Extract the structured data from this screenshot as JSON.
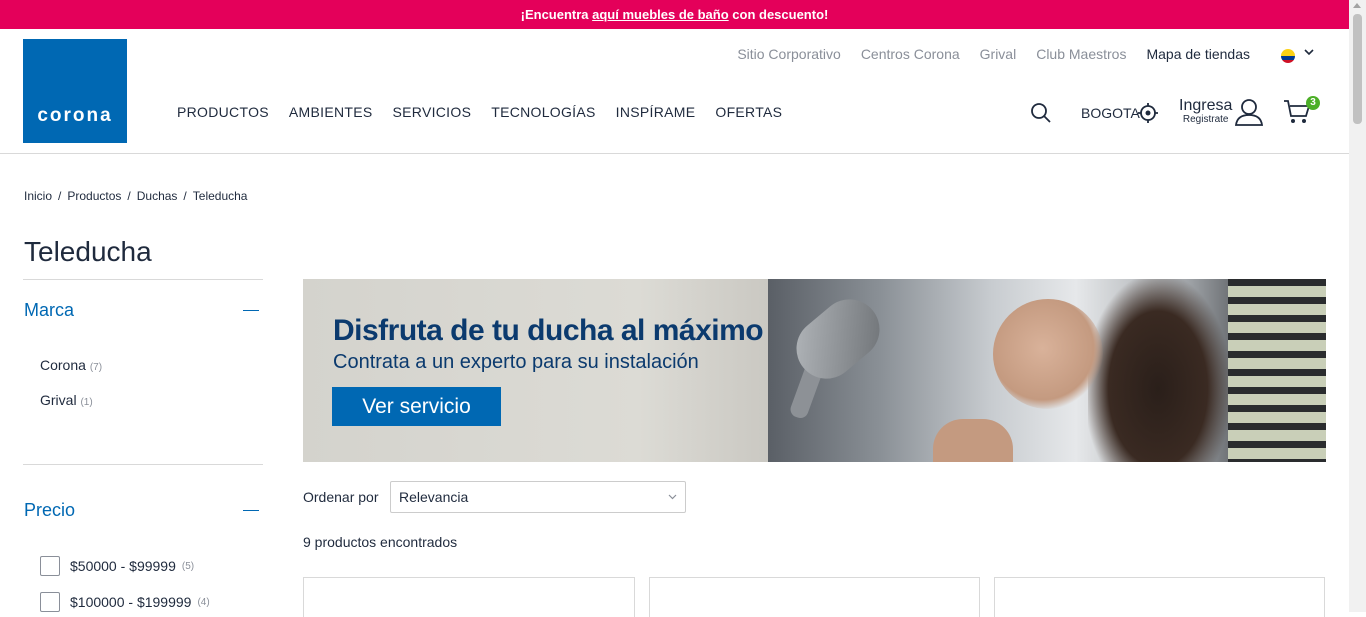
{
  "promo": {
    "prefix": "¡Encuentra ",
    "link": "aquí muebles de baño",
    "suffix": " con descuento!"
  },
  "logo": {
    "text": "corona"
  },
  "top_links": [
    "Sitio Corporativo",
    "Centros Corona",
    "Grival",
    "Club Maestros",
    "Mapa de tiendas"
  ],
  "main_nav": [
    "PRODUCTOS",
    "AMBIENTES",
    "SERVICIOS",
    "TECNOLOGÍAS",
    "INSPÍRAME",
    "OFERTAS"
  ],
  "header": {
    "city": "BOGOTA",
    "login_label": "Ingresa",
    "register_label": "Registrate",
    "cart_count": "3"
  },
  "breadcrumb": [
    "Inicio",
    "Productos",
    "Duchas",
    "Teleducha"
  ],
  "page_title": "Teleducha",
  "filters": {
    "brand": {
      "title": "Marca",
      "items": [
        {
          "label": "Corona",
          "count": "(7)"
        },
        {
          "label": "Grival",
          "count": "(1)"
        }
      ]
    },
    "price": {
      "title": "Precio",
      "items": [
        {
          "label": "$50000 - $99999",
          "count": "(5)"
        },
        {
          "label": "$100000 - $199999",
          "count": "(4)"
        }
      ]
    }
  },
  "banner": {
    "headline": "Disfruta de tu ducha al máximo",
    "subline": "Contrata a un experto para su instalación",
    "cta": "Ver servicio"
  },
  "sort": {
    "label": "Ordenar por",
    "value": "Relevancia"
  },
  "results_text": "9 productos encontrados",
  "colors": {
    "promo": "#e4005a",
    "brand_blue": "#0068b3",
    "cart_badge": "#4caf27"
  }
}
